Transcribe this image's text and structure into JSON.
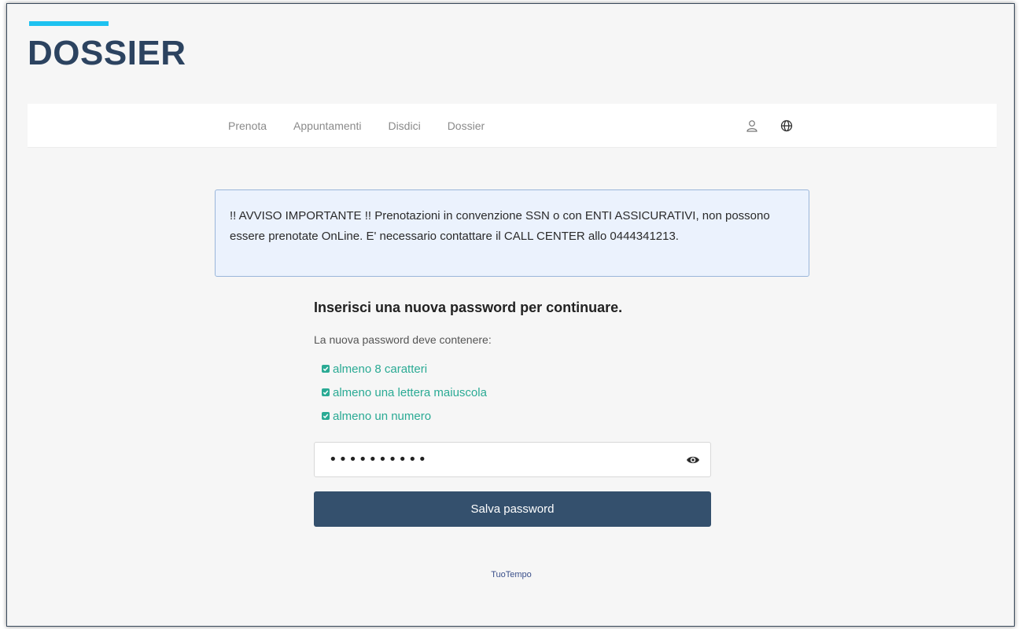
{
  "brand": {
    "title": "DOSSIER"
  },
  "nav": {
    "links": [
      "Prenota",
      "Appuntamenti",
      "Disdici",
      "Dossier"
    ],
    "icons": [
      "user-icon",
      "globe-icon"
    ]
  },
  "notice": {
    "text": "!! AVVISO IMPORTANTE !! Prenotazioni in convenzione SSN o con ENTI ASSICURATIVI, non possono essere prenotate OnLine. E' necessario contattare il CALL CENTER allo 0444341213."
  },
  "form": {
    "title": "Inserisci una nuova password per continuare.",
    "subtitle": "La nuova password deve contenere:",
    "rules": [
      "almeno 8 caratteri",
      "almeno una lettera maiuscola",
      "almeno un numero"
    ],
    "password_value": "••••••••••",
    "save_label": "Salva password"
  },
  "footer": {
    "link": "TuoTempo"
  },
  "colors": {
    "accent": "#1ec2f0",
    "brand": "#2c4360",
    "button": "#34506d",
    "success": "#2aaa94"
  }
}
